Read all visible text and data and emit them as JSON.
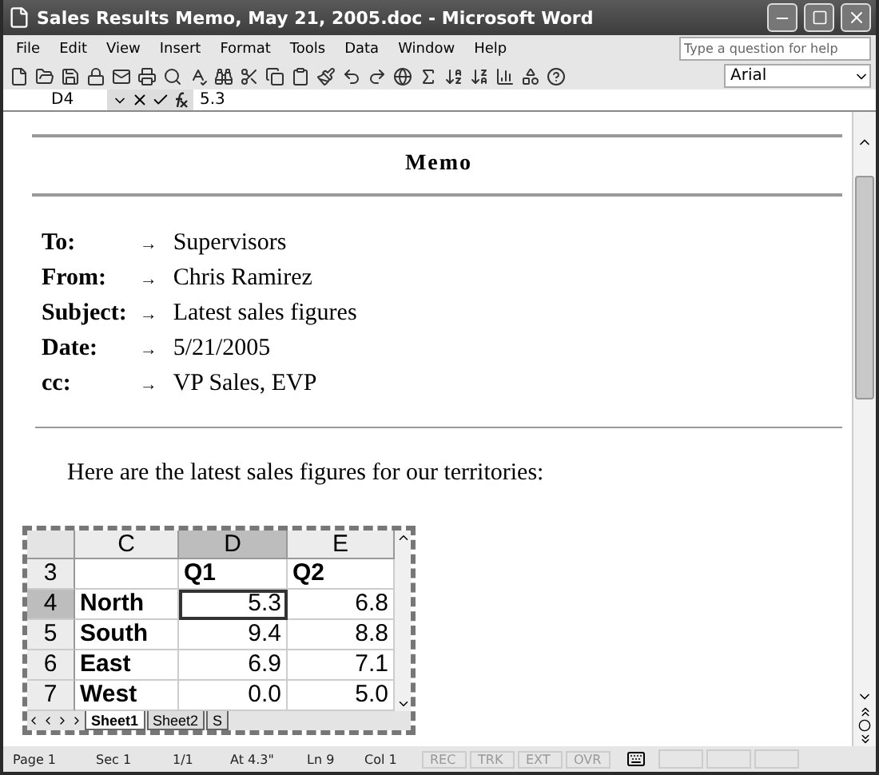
{
  "window": {
    "title": "Sales Results Memo, May 21, 2005.doc - Microsoft Word"
  },
  "menu": [
    "File",
    "Edit",
    "View",
    "Insert",
    "Format",
    "Tools",
    "Data",
    "Window",
    "Help"
  ],
  "help_search": {
    "placeholder": "Type a question for help"
  },
  "font_box": {
    "value": "Arial"
  },
  "formula_bar": {
    "cell_ref": "D4",
    "value": "5.3"
  },
  "memo": {
    "title": "Memo",
    "fields": [
      {
        "label": "To:",
        "tab": "→",
        "value": "Supervisors"
      },
      {
        "label": "From:",
        "tab": "→",
        "value": "Chris Ramirez"
      },
      {
        "label": "Subject:",
        "tab": "→",
        "value": "Latest sales figures"
      },
      {
        "label": "Date:",
        "tab": "→",
        "value": "5/21/2005"
      },
      {
        "label": "cc:",
        "tab": "→",
        "value": "VP Sales, EVP"
      }
    ],
    "paragraph": "Here are the latest sales figures for our territories:"
  },
  "spreadsheet": {
    "columns": [
      {
        "label": "C",
        "selected": false
      },
      {
        "label": "D",
        "selected": true
      },
      {
        "label": "E",
        "selected": false
      }
    ],
    "rows": [
      {
        "header": "3",
        "selected": false,
        "cells": [
          {
            "active": false
          },
          {
            "text": "Q1",
            "bold": true,
            "active": false
          },
          {
            "text": "Q2",
            "bold": true,
            "active": false
          }
        ]
      },
      {
        "header": "4",
        "selected": true,
        "cells": [
          {
            "text": "North",
            "bold": true,
            "active": false
          },
          {
            "text": "5.3",
            "bold": false,
            "active": true
          },
          {
            "text": "6.8",
            "bold": false,
            "active": false
          }
        ]
      },
      {
        "header": "5",
        "selected": false,
        "cells": [
          {
            "text": "South",
            "bold": true,
            "active": false
          },
          {
            "text": "9.4",
            "bold": false,
            "active": false
          },
          {
            "text": "8.8",
            "bold": false,
            "active": false
          }
        ]
      },
      {
        "header": "6",
        "selected": false,
        "cells": [
          {
            "text": "East",
            "bold": true,
            "active": false
          },
          {
            "text": "6.9",
            "bold": false,
            "active": false
          },
          {
            "text": "7.1",
            "bold": false,
            "active": false
          }
        ]
      },
      {
        "header": "7",
        "selected": false,
        "cells": [
          {
            "text": "West",
            "bold": true,
            "active": false
          },
          {
            "text": "0.0",
            "bold": false,
            "active": false
          },
          {
            "text": "5.0",
            "bold": false,
            "active": false
          }
        ]
      }
    ],
    "sheet_tabs": [
      {
        "label": "Sheet1",
        "selected": true
      },
      {
        "label": "Sheet2",
        "selected": false
      },
      {
        "label": "S",
        "selected": false
      }
    ]
  },
  "status_bar": [
    {
      "text": "Page 1",
      "disabled": false
    },
    {
      "text": "Sec 1",
      "disabled": false
    },
    {
      "text": "1/1",
      "disabled": false
    },
    {
      "text": "At 4.3\"",
      "disabled": false
    },
    {
      "text": "Ln 9",
      "disabled": false
    },
    {
      "text": "Col 1",
      "disabled": false
    },
    {
      "text": "REC",
      "disabled": true
    },
    {
      "text": "TRK",
      "disabled": true
    },
    {
      "text": "EXT",
      "disabled": true
    },
    {
      "text": "OVR",
      "disabled": true
    }
  ]
}
